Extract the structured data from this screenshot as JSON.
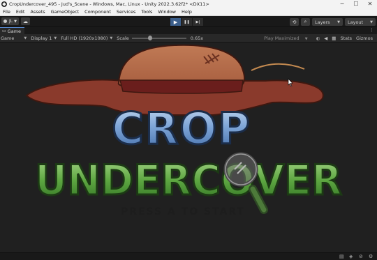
{
  "window": {
    "title": "CropUndercover_495 - Jud's_Scene - Windows, Mac, Linux - Unity 2022.3.62f2* <DX11>",
    "minimize_glyph": "─",
    "maximize_glyph": "☐",
    "close_glyph": "✕"
  },
  "menu": [
    "File",
    "Edit",
    "Assets",
    "GameObject",
    "Component",
    "Services",
    "Tools",
    "Window",
    "Help"
  ],
  "toolbar": {
    "account_label": "JL",
    "cloud_glyph": "☁",
    "play_glyph": "▶",
    "pause_glyph": "❚❚",
    "step_glyph": "▶|",
    "history_glyph": "⟲",
    "search_glyph": "⌕",
    "layers_label": "Layers",
    "layout_label": "Layout"
  },
  "tab": {
    "label": "Game",
    "menu_glyph": "⋮"
  },
  "game_bar": {
    "mode": "Game",
    "display": "Display 1",
    "resolution": "Full HD (1920x1080)",
    "scale_label": "Scale",
    "scale_value": "0.65x",
    "scale_fraction": 0.3,
    "play_mode": "Play Maximized",
    "stats_label": "Stats",
    "gizmos_label": "Gizmos"
  },
  "game_view": {
    "logo_line1": "CROP",
    "logo_line2": "UNDERCOVER",
    "prompt": "PRESS A TO START"
  },
  "colors": {
    "hat_brim": "#8a3a2c",
    "hat_crown": "#b56a48",
    "hat_band": "#6a1e1c",
    "crop_blue": "#7fa6d8",
    "undercover_green": "#5da641",
    "play_active": "#3c5f8c"
  }
}
